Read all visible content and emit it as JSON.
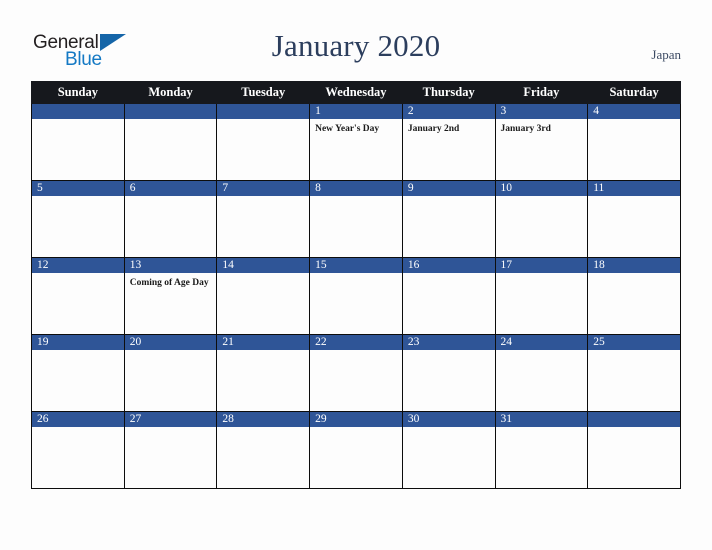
{
  "brand": {
    "name_part1": "General",
    "name_part2": "Blue",
    "triangle_icon": "triangle-icon",
    "colors": {
      "part1": "#231f20",
      "part2": "#1479c4",
      "triangle": "#1565a8"
    }
  },
  "header": {
    "title": "January 2020",
    "country": "Japan",
    "title_color": "#2c3e5d"
  },
  "theme": {
    "header_row_bg": "#16181d",
    "day_bar_bg": "#2f5597",
    "cell_bg": "#fdfdfd",
    "page_bg": "#fdfdfd",
    "border": "#0d0d0d"
  },
  "calendar": {
    "month": "January",
    "year": "2020",
    "weekday_headers": [
      "Sunday",
      "Monday",
      "Tuesday",
      "Wednesday",
      "Thursday",
      "Friday",
      "Saturday"
    ],
    "weeks": [
      [
        {
          "day": "",
          "events": []
        },
        {
          "day": "",
          "events": []
        },
        {
          "day": "",
          "events": []
        },
        {
          "day": "1",
          "events": [
            "New Year's Day"
          ]
        },
        {
          "day": "2",
          "events": [
            "January 2nd"
          ]
        },
        {
          "day": "3",
          "events": [
            "January 3rd"
          ]
        },
        {
          "day": "4",
          "events": []
        }
      ],
      [
        {
          "day": "5",
          "events": []
        },
        {
          "day": "6",
          "events": []
        },
        {
          "day": "7",
          "events": []
        },
        {
          "day": "8",
          "events": []
        },
        {
          "day": "9",
          "events": []
        },
        {
          "day": "10",
          "events": []
        },
        {
          "day": "11",
          "events": []
        }
      ],
      [
        {
          "day": "12",
          "events": []
        },
        {
          "day": "13",
          "events": [
            "Coming of Age Day"
          ]
        },
        {
          "day": "14",
          "events": []
        },
        {
          "day": "15",
          "events": []
        },
        {
          "day": "16",
          "events": []
        },
        {
          "day": "17",
          "events": []
        },
        {
          "day": "18",
          "events": []
        }
      ],
      [
        {
          "day": "19",
          "events": []
        },
        {
          "day": "20",
          "events": []
        },
        {
          "day": "21",
          "events": []
        },
        {
          "day": "22",
          "events": []
        },
        {
          "day": "23",
          "events": []
        },
        {
          "day": "24",
          "events": []
        },
        {
          "day": "25",
          "events": []
        }
      ],
      [
        {
          "day": "26",
          "events": []
        },
        {
          "day": "27",
          "events": []
        },
        {
          "day": "28",
          "events": []
        },
        {
          "day": "29",
          "events": []
        },
        {
          "day": "30",
          "events": []
        },
        {
          "day": "31",
          "events": []
        },
        {
          "day": "",
          "events": []
        }
      ]
    ]
  }
}
